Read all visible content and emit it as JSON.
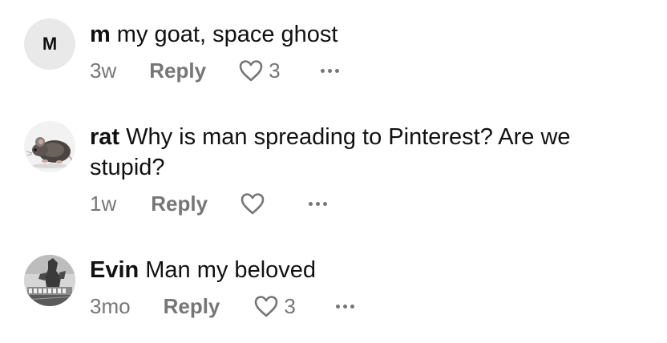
{
  "comments": [
    {
      "avatar_letter": "M",
      "username": "m",
      "text": "my goat, space ghost",
      "time": "3w",
      "reply_label": "Reply",
      "likes": "3",
      "avatar_icon": "letter-avatar"
    },
    {
      "username": "rat",
      "text": "Why is man spreading to Pinterest? Are we stupid?",
      "time": "1w",
      "reply_label": "Reply",
      "likes": "",
      "avatar_icon": "rat-photo-avatar"
    },
    {
      "username": "Evin",
      "text": "Man my beloved",
      "time": "3mo",
      "reply_label": "Reply",
      "likes": "3",
      "avatar_icon": "monster-photo-avatar"
    }
  ],
  "colors": {
    "text_primary": "#111111",
    "text_secondary": "#767676",
    "avatar_bg": "#e9e9e9"
  },
  "icons": {
    "like": "heart-outline-icon",
    "more": "ellipsis-icon"
  }
}
